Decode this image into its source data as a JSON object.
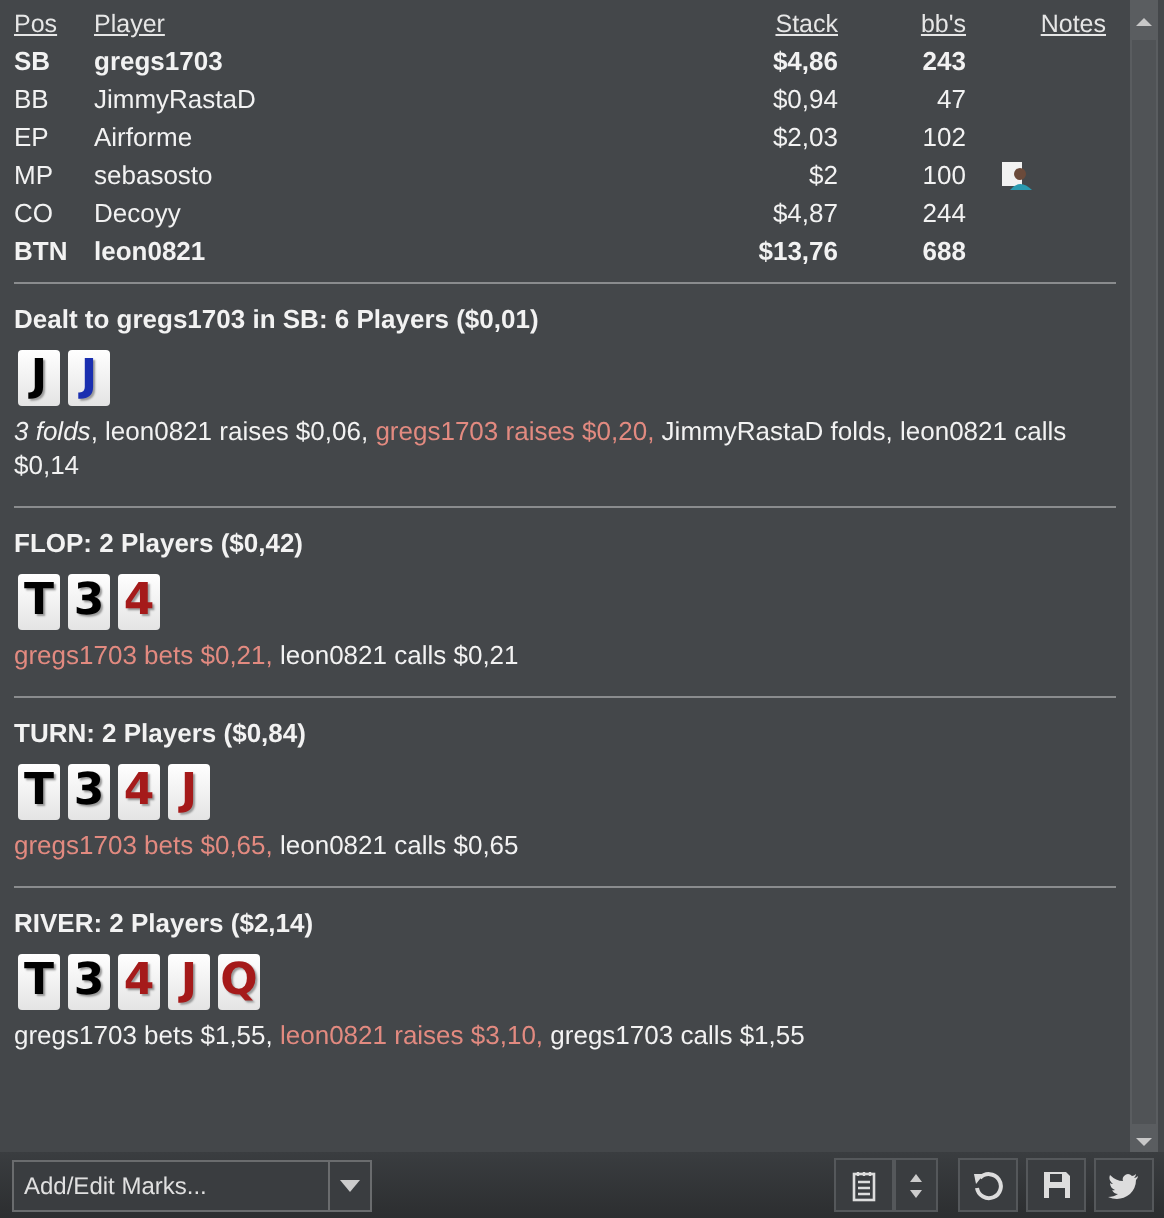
{
  "players": {
    "columns": [
      "Pos",
      "Player",
      "Stack",
      "bb's",
      "Notes"
    ],
    "rows": [
      {
        "pos": "SB",
        "player": "gregs1703",
        "stack": "$4,86",
        "bbs": "243",
        "bold": true,
        "has_note": false
      },
      {
        "pos": "BB",
        "player": "JimmyRastaD",
        "stack": "$0,94",
        "bbs": "47",
        "bold": false,
        "has_note": false
      },
      {
        "pos": "EP",
        "player": "Airforme",
        "stack": "$2,03",
        "bbs": "102",
        "bold": false,
        "has_note": false
      },
      {
        "pos": "MP",
        "player": "sebasosto",
        "stack": "$2",
        "bbs": "100",
        "bold": false,
        "has_note": true
      },
      {
        "pos": "CO",
        "player": "Decoyy",
        "stack": "$4,87",
        "bbs": "244",
        "bold": false,
        "has_note": false
      },
      {
        "pos": "BTN",
        "player": "leon0821",
        "stack": "$13,76",
        "bbs": "688",
        "bold": true,
        "has_note": false
      }
    ]
  },
  "streets": [
    {
      "heading": "Dealt to gregs1703 in SB: 6 Players ($0,01)",
      "cards": [
        {
          "rank": "J",
          "color": "#000000"
        },
        {
          "rank": "J",
          "color": "#1a2fb0"
        }
      ],
      "actions": [
        {
          "kind": "italic",
          "text": "3 folds"
        },
        {
          "kind": "plain",
          "text": ", leon0821 raises $0,06, "
        },
        {
          "kind": "hero",
          "text": "gregs1703 raises $0,20,"
        },
        {
          "kind": "plain",
          "text": " JimmyRastaD folds, leon0821 calls $0,14"
        }
      ]
    },
    {
      "heading": "FLOP: 2 Players ($0,42)",
      "cards": [
        {
          "rank": "T",
          "color": "#000000"
        },
        {
          "rank": "3",
          "color": "#000000"
        },
        {
          "rank": "4",
          "color": "#a51a1a"
        }
      ],
      "actions": [
        {
          "kind": "hero",
          "text": "gregs1703 bets $0,21,"
        },
        {
          "kind": "plain",
          "text": " leon0821 calls $0,21"
        }
      ]
    },
    {
      "heading": "TURN: 2 Players ($0,84)",
      "cards": [
        {
          "rank": "T",
          "color": "#000000"
        },
        {
          "rank": "3",
          "color": "#000000"
        },
        {
          "rank": "4",
          "color": "#a51a1a"
        },
        {
          "rank": "J",
          "color": "#a51a1a"
        }
      ],
      "actions": [
        {
          "kind": "hero",
          "text": "gregs1703 bets $0,65,"
        },
        {
          "kind": "plain",
          "text": " leon0821 calls $0,65"
        }
      ]
    },
    {
      "heading": "RIVER: 2 Players ($2,14)",
      "cards": [
        {
          "rank": "T",
          "color": "#000000"
        },
        {
          "rank": "3",
          "color": "#000000"
        },
        {
          "rank": "4",
          "color": "#a51a1a"
        },
        {
          "rank": "J",
          "color": "#a51a1a"
        },
        {
          "rank": "Q",
          "color": "#a51a1a"
        }
      ],
      "actions": [
        {
          "kind": "plain",
          "text": "gregs1703 bets $1,55, "
        },
        {
          "kind": "hero",
          "text": "leon0821 raises $3,10,"
        },
        {
          "kind": "plain",
          "text": " gregs1703 calls $1,55"
        }
      ]
    }
  ],
  "toolbar": {
    "marks_dropdown": {
      "value": "Add/Edit Marks..."
    }
  }
}
